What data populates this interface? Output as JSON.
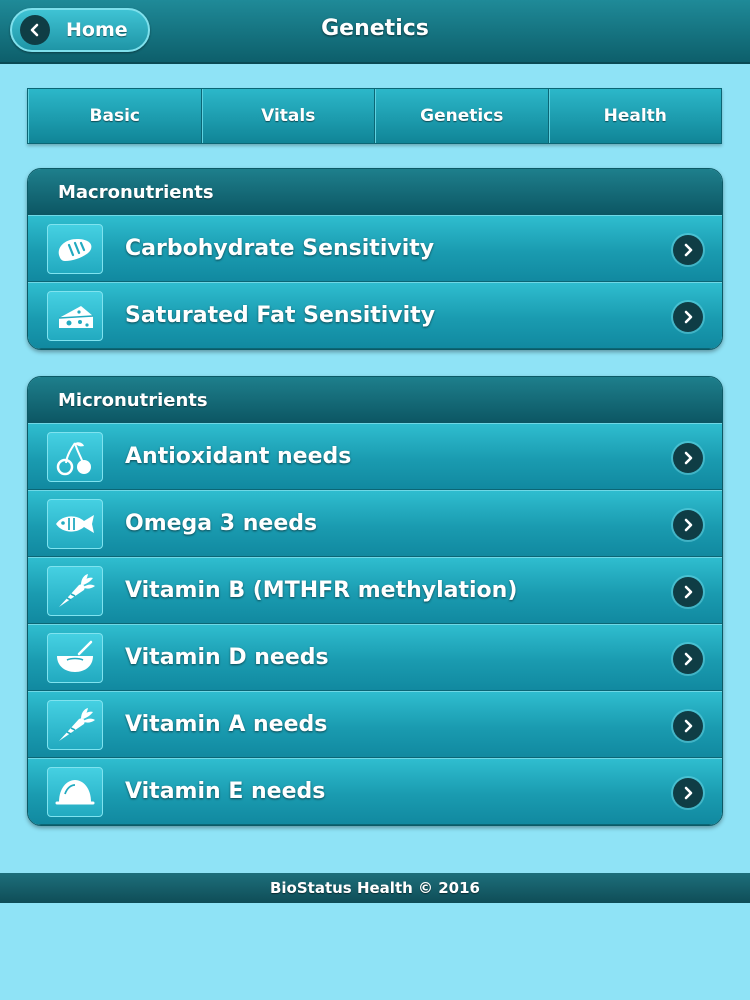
{
  "header": {
    "back_label": "Home",
    "title": "Genetics"
  },
  "tabs": [
    {
      "label": "Basic"
    },
    {
      "label": "Vitals"
    },
    {
      "label": "Genetics"
    },
    {
      "label": "Health"
    }
  ],
  "macronutrients": {
    "title": "Macronutrients",
    "items": [
      {
        "label": "Carbohydrate Sensitivity",
        "icon": "bread-icon"
      },
      {
        "label": "Saturated Fat Sensitivity",
        "icon": "cheese-icon"
      }
    ]
  },
  "micronutrients": {
    "title": "Micronutrients",
    "items": [
      {
        "label": "Antioxidant needs",
        "icon": "cherry-icon"
      },
      {
        "label": "Omega 3 needs",
        "icon": "fish-icon"
      },
      {
        "label": "Vitamin B (MTHFR methylation)",
        "icon": "carrot-icon"
      },
      {
        "label": "Vitamin D needs",
        "icon": "bowl-icon"
      },
      {
        "label": "Vitamin A needs",
        "icon": "carrot-icon"
      },
      {
        "label": "Vitamin E needs",
        "icon": "dome-icon"
      }
    ]
  },
  "footer": {
    "text": "BioStatus Health © 2016"
  },
  "colors": {
    "background": "#8fe3f6",
    "header": "#0d5f6b",
    "row": "#1a9bb0",
    "arrow_circle": "#0f3d45"
  }
}
